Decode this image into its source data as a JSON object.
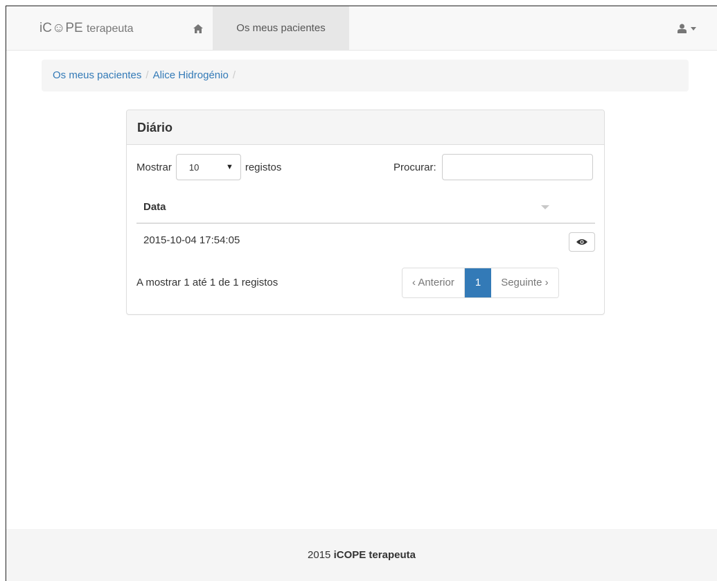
{
  "navbar": {
    "brand_main": "iC☺PE",
    "brand_sub": "terapeuta",
    "home_icon": "home-icon",
    "active_item": "Os meus pacientes",
    "user_icon": "user-icon"
  },
  "breadcrumb": {
    "items": [
      "Os meus pacientes",
      "Alice Hidrogénio"
    ]
  },
  "panel": {
    "title": "Diário",
    "length_prefix": "Mostrar",
    "length_value": "10",
    "length_suffix": "registos",
    "search_label": "Procurar:",
    "search_value": "",
    "table": {
      "columns": [
        "Data"
      ],
      "rows": [
        {
          "date": "2015-10-04 17:54:05",
          "action_icon": "eye-icon"
        }
      ]
    },
    "info": "A mostrar 1 até 1 de 1 registos",
    "pagination": {
      "prev": "‹ Anterior",
      "current": "1",
      "next": "Seguinte ›"
    }
  },
  "footer": {
    "year": "2015",
    "name": "iCOPE terapeuta"
  },
  "colors": {
    "link": "#337ab7",
    "active_page": "#337ab7",
    "navbar_bg": "#f8f8f8",
    "footer_bg": "#f5f5f5"
  }
}
